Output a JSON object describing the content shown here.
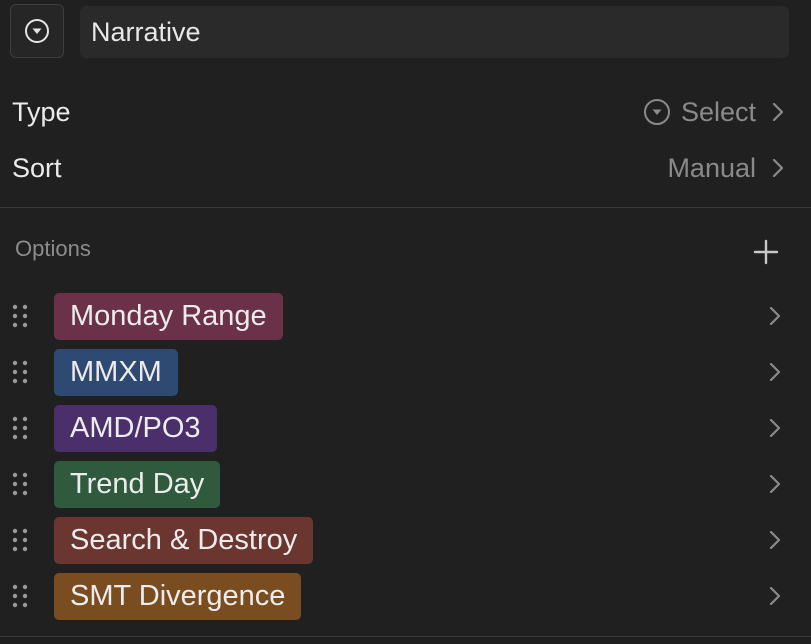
{
  "header": {
    "name_value": "Narrative"
  },
  "properties": [
    {
      "label": "Type",
      "value": "Select",
      "value_icon": "circle-chevron-down-icon"
    },
    {
      "label": "Sort",
      "value": "Manual"
    }
  ],
  "options_section": {
    "label": "Options",
    "add_icon": "plus-icon"
  },
  "options": [
    {
      "label": "Monday Range",
      "color": "#6b3148"
    },
    {
      "label": "MMXM",
      "color": "#2f4a72"
    },
    {
      "label": "AMD/PO3",
      "color": "#4b2f6b"
    },
    {
      "label": "Trend Day",
      "color": "#2f5a3e"
    },
    {
      "label": "Search & Destroy",
      "color": "#6b3530"
    },
    {
      "label": "SMT Divergence",
      "color": "#7a4d20"
    }
  ],
  "colors": {
    "background": "#202020",
    "field": "#2a2a2a",
    "muted_text": "#8a8a8a"
  }
}
